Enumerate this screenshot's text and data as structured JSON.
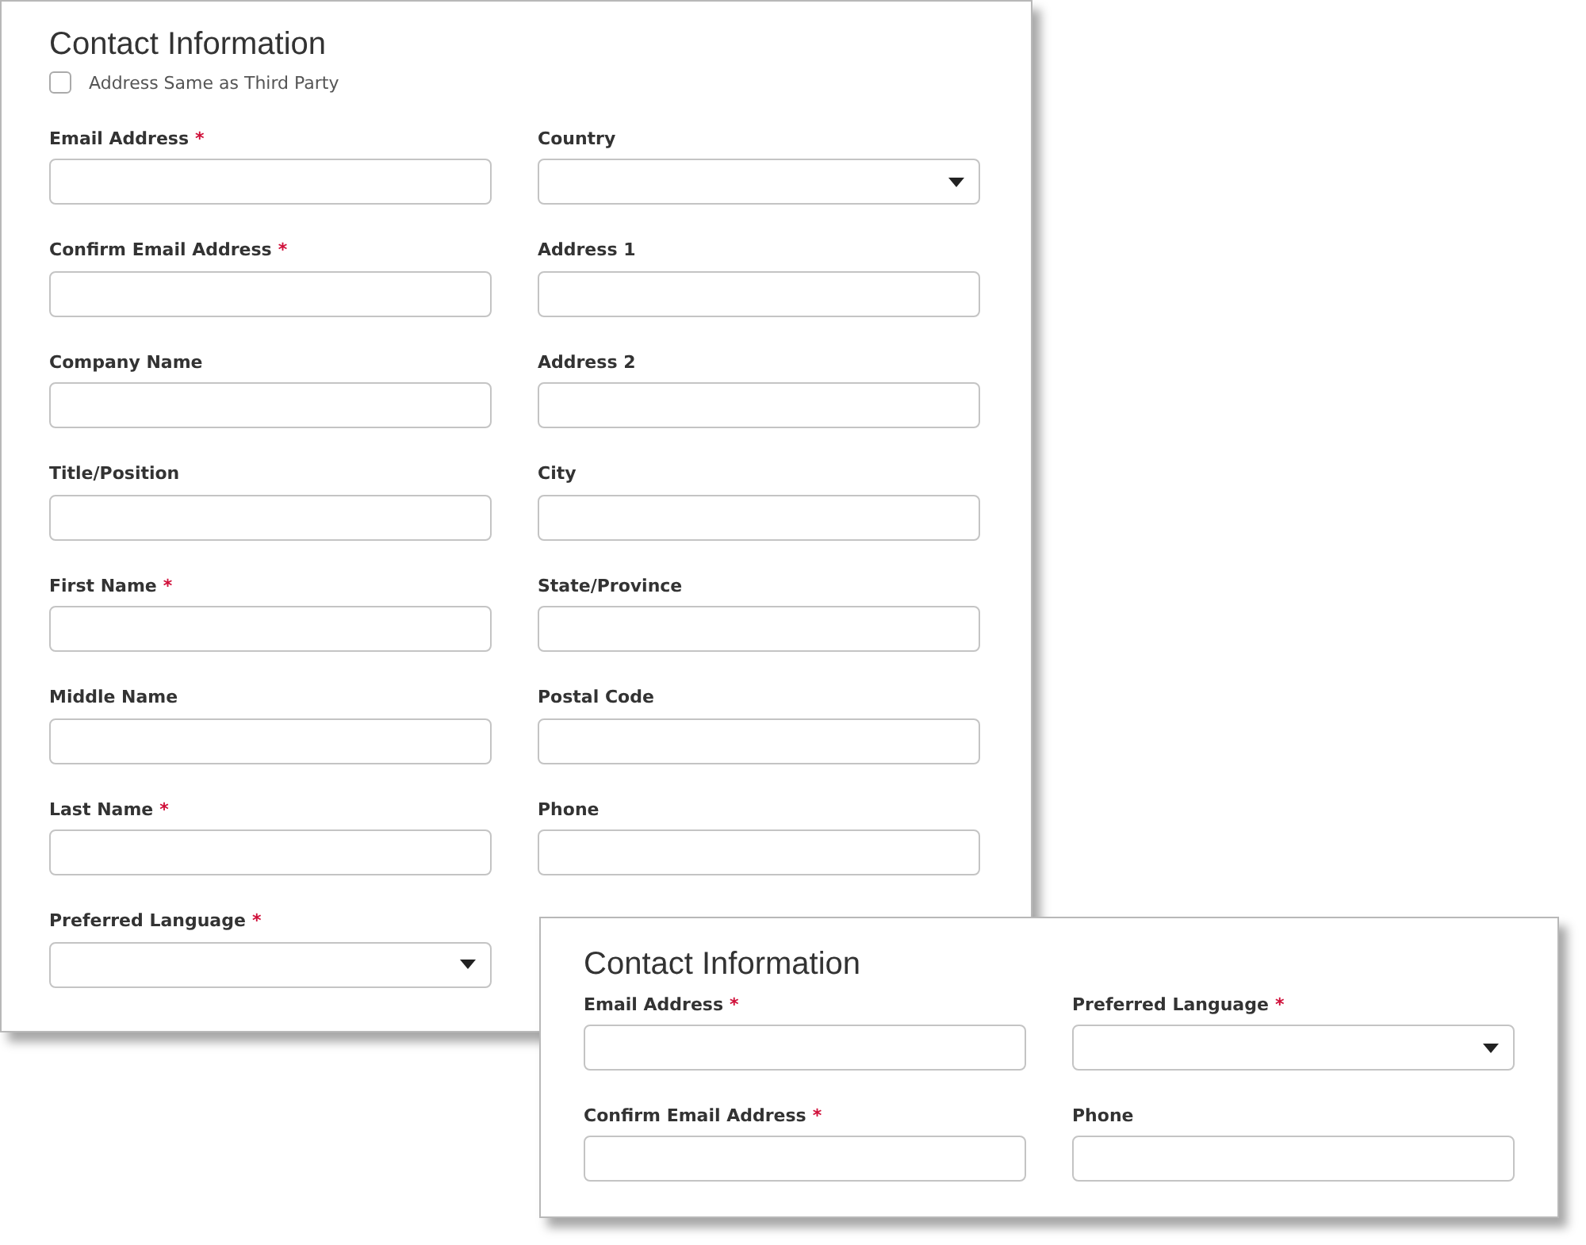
{
  "panels": [
    {
      "title": "Contact Information",
      "checkbox": {
        "label": "Address Same as Third Party",
        "checked": false
      },
      "columns": [
        [
          {
            "label": "Email Address",
            "required_mark": "*",
            "kind": "text"
          },
          {
            "label": "Confirm Email Address",
            "required_mark": "*",
            "kind": "text"
          },
          {
            "label": "Company Name",
            "kind": "text"
          },
          {
            "label": "Title/Position",
            "kind": "text"
          },
          {
            "label": "First Name",
            "required_mark": "*",
            "kind": "text"
          },
          {
            "label": "Middle Name",
            "kind": "text"
          },
          {
            "label": "Last Name",
            "required_mark": "*",
            "kind": "text"
          },
          {
            "label": "Preferred Language",
            "required_mark": "*",
            "kind": "select"
          }
        ],
        [
          {
            "label": "Country",
            "kind": "select"
          },
          {
            "label": "Address 1",
            "kind": "text"
          },
          {
            "label": "Address 2",
            "kind": "text"
          },
          {
            "label": "City",
            "kind": "text"
          },
          {
            "label": "State/Province",
            "kind": "text"
          },
          {
            "label": "Postal Code",
            "kind": "text"
          },
          {
            "label": "Phone",
            "kind": "text"
          }
        ]
      ]
    },
    {
      "title": "Contact Information",
      "columns": [
        [
          {
            "label": "Email Address",
            "required_mark": "*",
            "kind": "text"
          },
          {
            "label": "Confirm Email Address",
            "required_mark": "*",
            "kind": "text"
          }
        ],
        [
          {
            "label": "Preferred Language",
            "required_mark": "*",
            "kind": "select"
          },
          {
            "label": "Phone",
            "kind": "text"
          }
        ]
      ]
    }
  ]
}
